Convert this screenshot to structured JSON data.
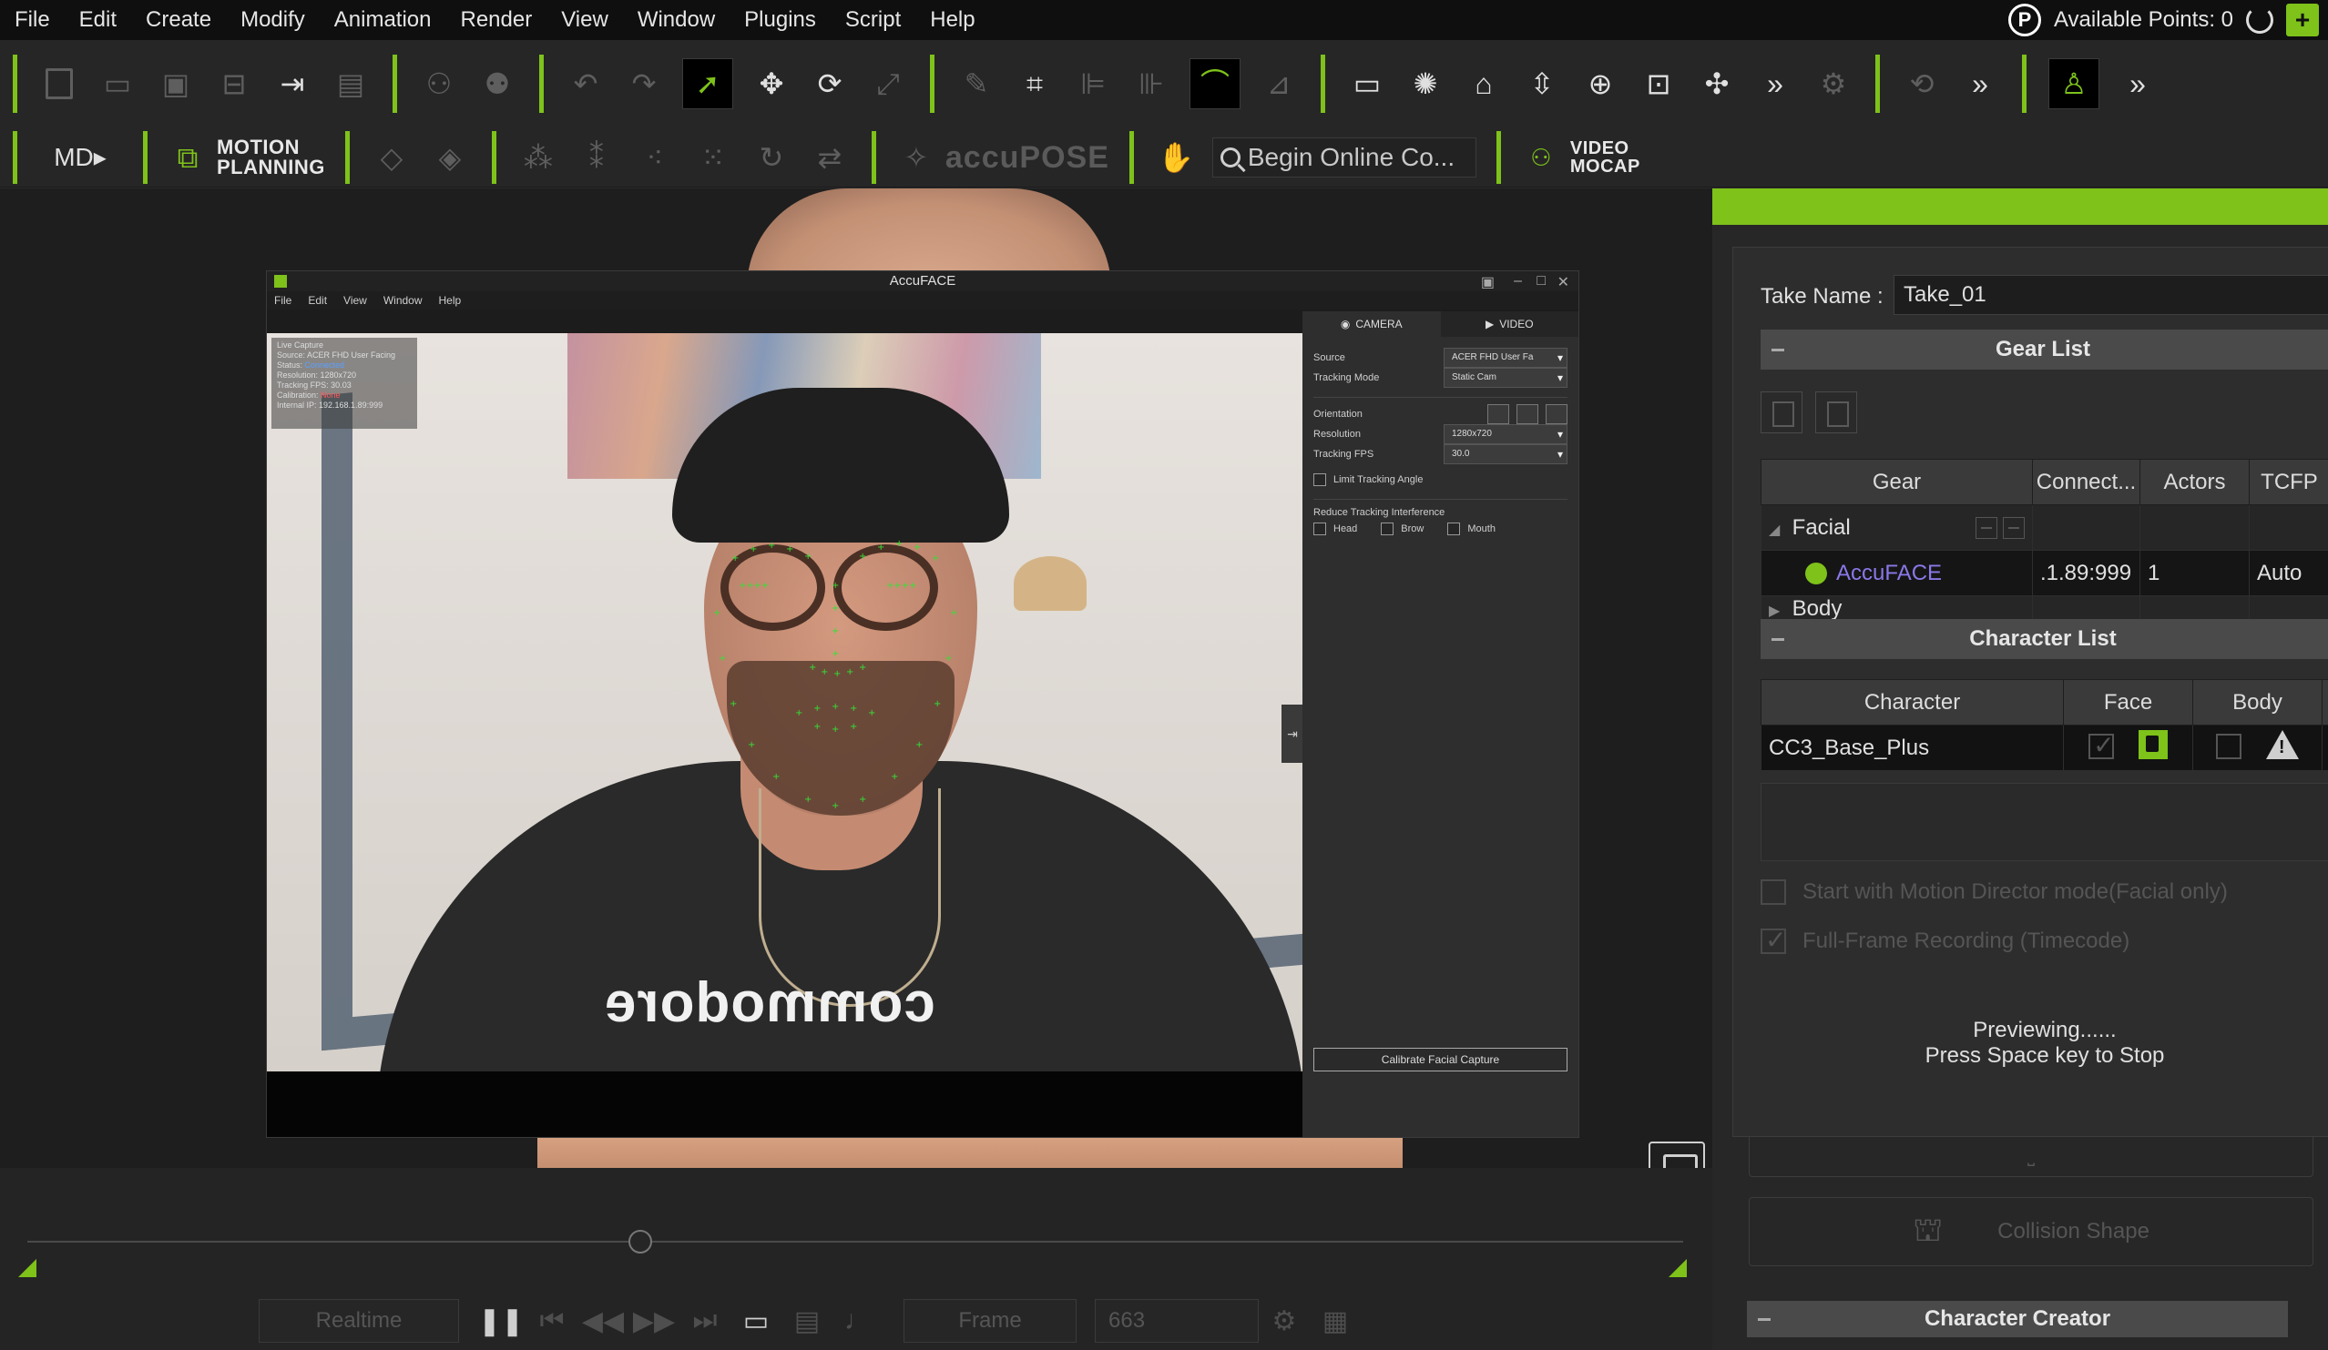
{
  "menu": [
    "File",
    "Edit",
    "Create",
    "Modify",
    "Animation",
    "Render",
    "View",
    "Window",
    "Plugins",
    "Script",
    "Help"
  ],
  "points": {
    "badge": "P",
    "label": "Available Points: 0",
    "add": "+"
  },
  "toolbar2": {
    "motion_planning": [
      "MOTION",
      "PLANNING"
    ],
    "accupose": "accuPOSE",
    "search_placeholder": "Begin Online Co...",
    "video_mocap": [
      "VIDEO",
      "MOCAP"
    ]
  },
  "accent_color": "#7ec21a",
  "accuface": {
    "title": "AccuFACE",
    "menu": [
      "File",
      "Edit",
      "View",
      "Window",
      "Help"
    ],
    "info": {
      "line1": "Live Capture",
      "source_label": "Source:",
      "source": "ACER FHD User Facing",
      "status_label": "Status:",
      "status": "Connected",
      "resolution": "Resolution:  1280x720",
      "fps": "Tracking FPS:  30.03",
      "calibration_label": "Calibration:",
      "calibration": "None",
      "ip": "Internal IP:  192.168.1.89:999"
    },
    "shirt_logo": "commodore",
    "tabs": {
      "camera": "CAMERA",
      "video": "VIDEO"
    },
    "source_label": "Source",
    "source_value": "ACER FHD User Fa",
    "tracking_mode_label": "Tracking Mode",
    "tracking_mode_value": "Static Cam",
    "orientation_label": "Orientation",
    "resolution_label": "Resolution",
    "resolution_value": "1280x720",
    "fps_label": "Tracking FPS",
    "fps_value": "30.0",
    "limit_angle": "Limit Tracking Angle",
    "reduce_label": "Reduce Tracking Interference",
    "reduce_head": "Head",
    "reduce_brow": "Brow",
    "reduce_mouth": "Mouth",
    "calibrate": "Calibrate Facial Capture"
  },
  "timeline": {
    "realtime": "Realtime",
    "frame_label": "Frame",
    "frame_value": "663"
  },
  "right_panel": {
    "take_name_label": "Take Name :",
    "take_name_value": "Take_01",
    "gear_list_title": "Gear List",
    "gear_columns": [
      "Gear",
      "Connect...",
      "Actors",
      "TCFP"
    ],
    "gear_groups": {
      "facial": "Facial",
      "body": "Body"
    },
    "gear_row": {
      "name": "AccuFACE",
      "connect": ".1.89:999",
      "actors": "1",
      "tcfp": "Auto"
    },
    "character_list_title": "Character List",
    "char_columns": [
      "Character",
      "Face",
      "Body"
    ],
    "char_row": {
      "name": "CC3_Base_Plus"
    },
    "opt_motion_director": "Start with Motion Director mode(Facial only)",
    "opt_full_frame": "Full-Frame Recording (Timecode)",
    "preview_line1": "Previewing......",
    "preview_line2": "Press Space key to Stop",
    "collision_shape": "Collision Shape",
    "character_creator": "Character Creator"
  }
}
